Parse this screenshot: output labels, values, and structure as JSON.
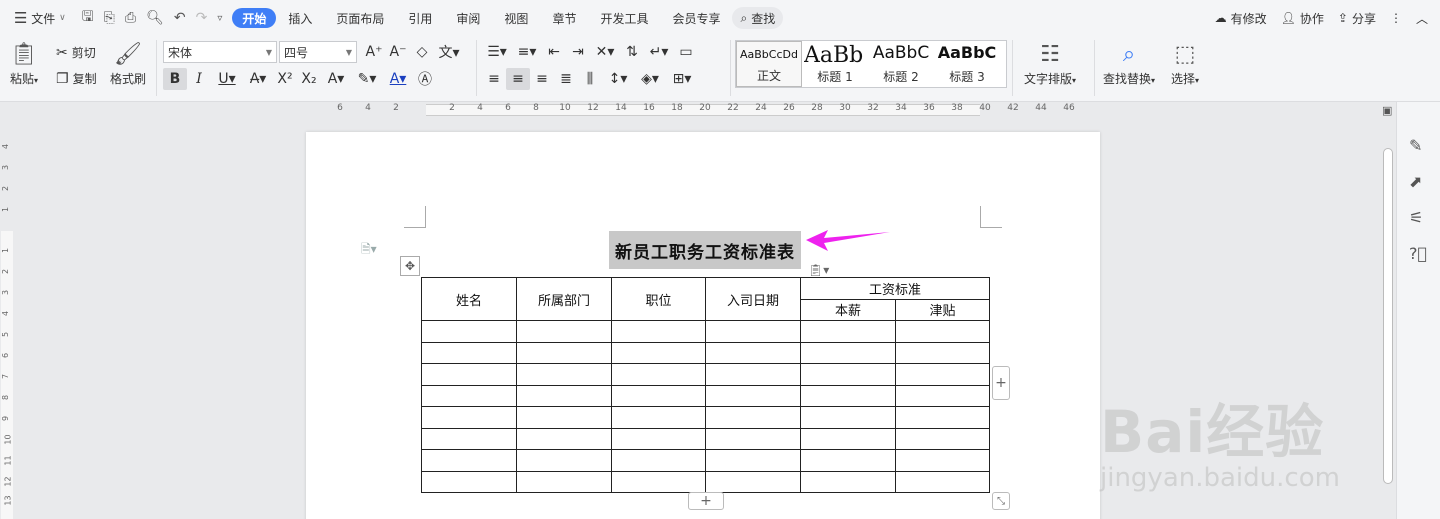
{
  "menubar": {
    "file_label": "文件",
    "tabs": [
      "开始",
      "插入",
      "页面布局",
      "引用",
      "审阅",
      "视图",
      "章节",
      "开发工具",
      "会员专享"
    ],
    "search_label": "查找",
    "modified_label": "有修改",
    "collab_label": "协作",
    "share_label": "分享"
  },
  "ribbon": {
    "paste_label": "粘贴",
    "cut_label": "剪切",
    "copy_label": "复制",
    "format_painter_label": "格式刷",
    "font_name": "宋体",
    "font_size": "四号",
    "styles": [
      {
        "preview": "AaBbCcDd",
        "name": "正文"
      },
      {
        "preview": "AaBb",
        "name": "标题 1"
      },
      {
        "preview": "AaBbC",
        "name": "标题 2"
      },
      {
        "preview": "AaBbC",
        "name": "标题 3"
      }
    ],
    "text_layout_label": "文字排版",
    "find_replace_label": "查找替换",
    "select_label": "选择"
  },
  "ruler": {
    "ticks": [
      "6",
      "4",
      "2",
      "2",
      "4",
      "6",
      "8",
      "10",
      "12",
      "14",
      "16",
      "18",
      "20",
      "22",
      "24",
      "26",
      "28",
      "30",
      "32",
      "34",
      "36",
      "38",
      "40",
      "42",
      "44",
      "46"
    ],
    "vticks": [
      "4",
      "3",
      "2",
      "1",
      "1",
      "2",
      "3",
      "4",
      "5",
      "6",
      "7",
      "8",
      "9",
      "10",
      "11",
      "12",
      "13"
    ]
  },
  "document": {
    "title": "新员工职务工资标准表",
    "table": {
      "headers": [
        "姓名",
        "所属部门",
        "职位",
        "入司日期"
      ],
      "group_header": "工资标准",
      "sub_headers": [
        "本薪",
        "津贴"
      ],
      "empty_rows": 8
    }
  },
  "watermark": {
    "brand": "Bai经验",
    "url": "jingyan.baidu.com"
  },
  "colors": {
    "accent": "#3f7ef6",
    "arrow": "#ee22ee"
  }
}
